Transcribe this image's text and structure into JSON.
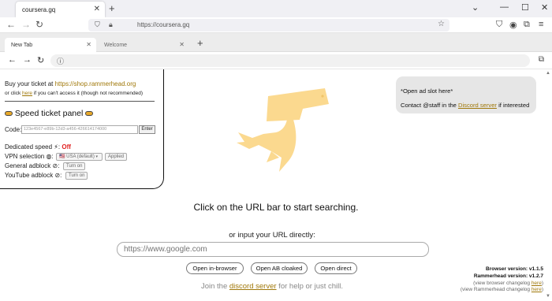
{
  "outer_browser": {
    "tab_title": "coursera.gq",
    "url": "https://coursera.gq",
    "icons": [
      "close-icon",
      "plus-icon",
      "back-arrow-icon",
      "forward-arrow-icon",
      "reload-icon",
      "shield-icon",
      "lock-icon",
      "star-icon",
      "pocket-icon",
      "account-icon",
      "extensions-icon",
      "menu-icon",
      "minimize-icon",
      "maximize-icon",
      "window-close-icon"
    ]
  },
  "inner_browser": {
    "tabs": [
      {
        "title": "New Tab"
      },
      {
        "title": "Welcome"
      }
    ],
    "icons": [
      "back-arrow-icon",
      "forward-arrow-icon",
      "reload-icon",
      "info-icon",
      "open-external-icon",
      "plus-icon"
    ]
  },
  "panel": {
    "buy_prefix": "Buy your ticket at ",
    "buy_link": "https://shop.rammerhead.org",
    "click_prefix": "or click ",
    "click_link": "here",
    "click_suffix": " if you can't access it (though not recommended)",
    "speed_title": "Speed ticket panel",
    "code_label": "Code:",
    "code_placeholder": "123e4567-e89b-12d3-a456-426614174000",
    "enter_label": "Enter",
    "dedicated_label": "Dedicated speed",
    "dedicated_value": "Off",
    "vpn_label": "VPN selection",
    "vpn_option": "🇺🇸 USA (default)",
    "applied_label": "Applied",
    "general_label": "General adblock",
    "youtube_label": "YouTube adblock",
    "turn_on_label": "Turn on"
  },
  "ad": {
    "line1": "*Open ad slot here*",
    "line2_prefix": "Contact @staff in the ",
    "line2_link": "Discord server",
    "line2_suffix": " if interested"
  },
  "main": {
    "click_text": "Click on the URL bar to start searching.",
    "or_input": "or input your URL directly:",
    "url_placeholder": "https://www.google.com",
    "btn_in_browser": "Open in-browser",
    "btn_ab_cloaked": "Open AB cloaked",
    "btn_direct": "Open direct",
    "join_prefix": "Join the ",
    "join_link": "discord server",
    "join_suffix": " for help or just chill."
  },
  "versions": {
    "browser_label": "Browser version:",
    "browser_version": "v1.1.5",
    "rammerhead_label": "Rammerhead version:",
    "rammerhead_version": "v1.2.7",
    "browser_changelog_prefix": "(view browser changelog ",
    "rammerhead_changelog_prefix": "(view Rammerhead changelog ",
    "here": "here",
    "close_paren": ")"
  },
  "colors": {
    "link": "#a0780a",
    "logo": "#fbd98f",
    "off": "#e02020",
    "pill": "#e8a92a"
  }
}
